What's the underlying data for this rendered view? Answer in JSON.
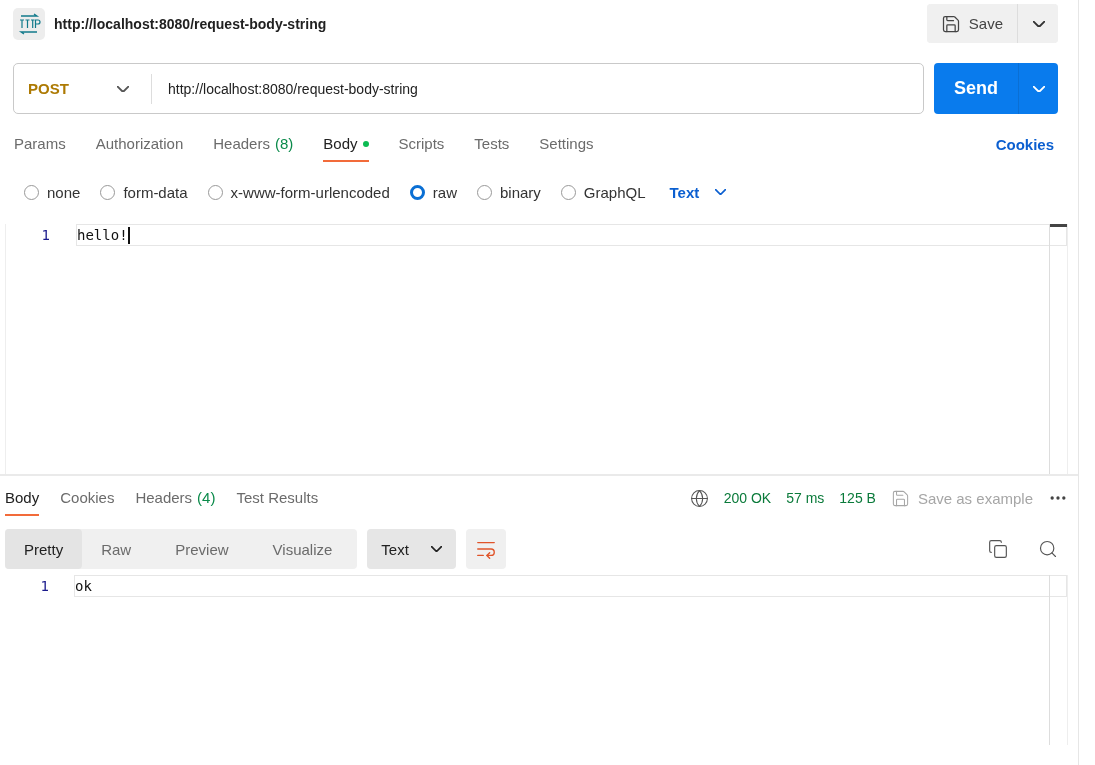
{
  "request": {
    "title": "http://localhost:8080/request-body-string",
    "save": "Save",
    "method": "POST",
    "url": "http://localhost:8080/request-body-string",
    "send": "Send"
  },
  "request_tabs": [
    {
      "label": "Params",
      "selected": false
    },
    {
      "label": "Authorization",
      "selected": false
    },
    {
      "label": "Headers",
      "count": "(8)",
      "selected": false
    },
    {
      "label": "Body",
      "selected": true,
      "modified": true
    },
    {
      "label": "Scripts",
      "selected": false
    },
    {
      "label": "Tests",
      "selected": false
    },
    {
      "label": "Settings",
      "selected": false
    }
  ],
  "cookies_link": "Cookies",
  "body_types": [
    {
      "label": "none",
      "selected": false
    },
    {
      "label": "form-data",
      "selected": false
    },
    {
      "label": "x-www-form-urlencoded",
      "selected": false
    },
    {
      "label": "raw",
      "selected": true
    },
    {
      "label": "binary",
      "selected": false
    },
    {
      "label": "GraphQL",
      "selected": false
    }
  ],
  "body_format": "Text",
  "request_body": [
    {
      "line": "1",
      "text": "hello!"
    }
  ],
  "response_tabs": [
    {
      "label": "Body",
      "selected": true
    },
    {
      "label": "Cookies",
      "selected": false
    },
    {
      "label": "Headers",
      "count": "(4)",
      "selected": false
    },
    {
      "label": "Test Results",
      "selected": false
    }
  ],
  "response_status": {
    "status": "200 OK",
    "time": "57 ms",
    "size": "125 B",
    "save_example": "Save as example"
  },
  "view_modes": [
    {
      "label": "Pretty",
      "selected": true
    },
    {
      "label": "Raw",
      "selected": false
    },
    {
      "label": "Preview",
      "selected": false
    },
    {
      "label": "Visualize",
      "selected": false
    }
  ],
  "response_format": "Text",
  "response_body": [
    {
      "line": "1",
      "text": "ok"
    }
  ]
}
